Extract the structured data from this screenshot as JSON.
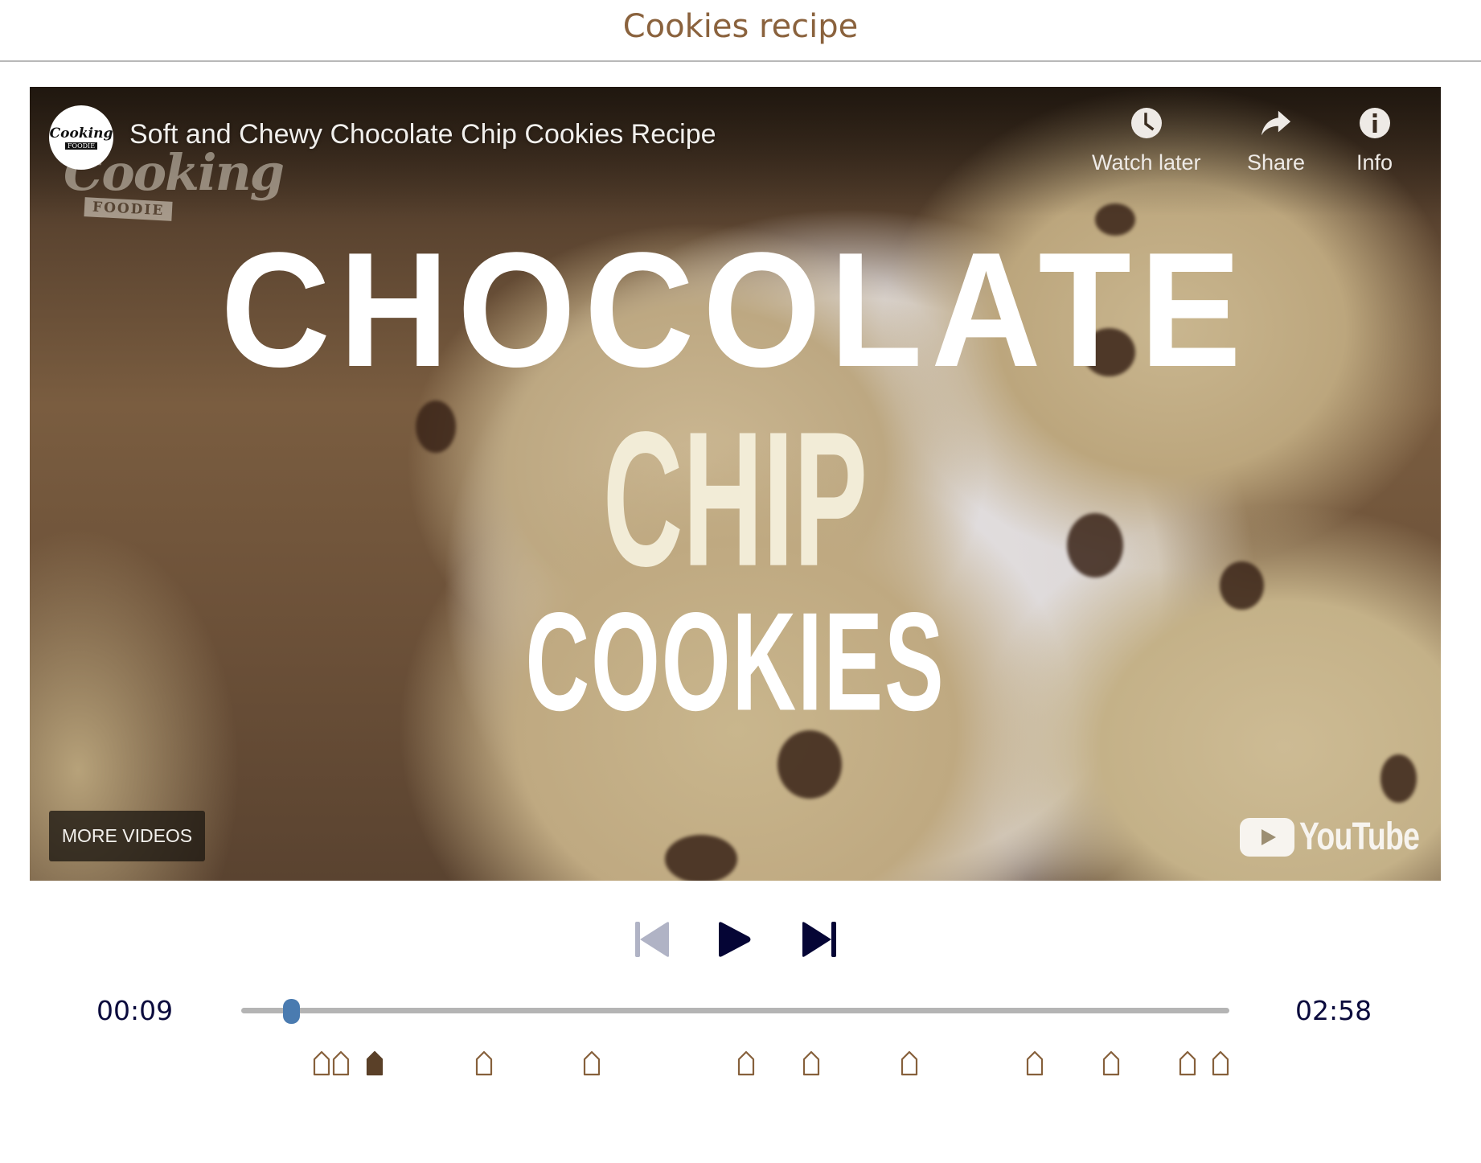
{
  "page": {
    "title": "Cookies recipe"
  },
  "video": {
    "title": "Soft and Chewy Chocolate Chip Cookies Recipe",
    "channel_logo": {
      "line1": "Cooking",
      "line2": "FOODIE"
    },
    "watermark": {
      "text": "Cooking",
      "band": "FOODIE"
    },
    "thumbnail_text": {
      "line1": "CHOCOLATE",
      "line2": "CHIP",
      "line3": "COOKIES"
    },
    "actions": [
      {
        "label": "Watch later",
        "icon": "clock-icon"
      },
      {
        "label": "Share",
        "icon": "share-arrow-icon"
      },
      {
        "label": "Info",
        "icon": "info-icon"
      }
    ],
    "more_videos_label": "MORE VIDEOS",
    "brand_label": "YouTube"
  },
  "player": {
    "controls": [
      {
        "name": "previous",
        "icon": "skip-previous-icon",
        "enabled": false,
        "color": "#b0b3c5"
      },
      {
        "name": "play",
        "icon": "play-icon",
        "enabled": true,
        "color": "#050535"
      },
      {
        "name": "next",
        "icon": "skip-next-icon",
        "enabled": true,
        "color": "#050535"
      }
    ],
    "current_time": "00:09",
    "duration": "02:58",
    "progress_fraction": 0.0506,
    "markers": [
      {
        "position_fraction": 0.081,
        "active": false
      },
      {
        "position_fraction": 0.101,
        "active": false
      },
      {
        "position_fraction": 0.135,
        "active": true
      },
      {
        "position_fraction": 0.246,
        "active": false
      },
      {
        "position_fraction": 0.355,
        "active": false
      },
      {
        "position_fraction": 0.511,
        "active": false
      },
      {
        "position_fraction": 0.577,
        "active": false
      },
      {
        "position_fraction": 0.676,
        "active": false
      },
      {
        "position_fraction": 0.803,
        "active": false
      },
      {
        "position_fraction": 0.88,
        "active": false
      },
      {
        "position_fraction": 0.958,
        "active": false
      },
      {
        "position_fraction": 0.991,
        "active": false
      }
    ]
  },
  "colors": {
    "title_brown": "#8a623d",
    "marker_outline": "#86603b",
    "marker_active": "#5a4028",
    "thumb_blue": "#4a7bb0",
    "track_gray": "#b4b4b4",
    "time_navy": "#0b0b3d"
  }
}
